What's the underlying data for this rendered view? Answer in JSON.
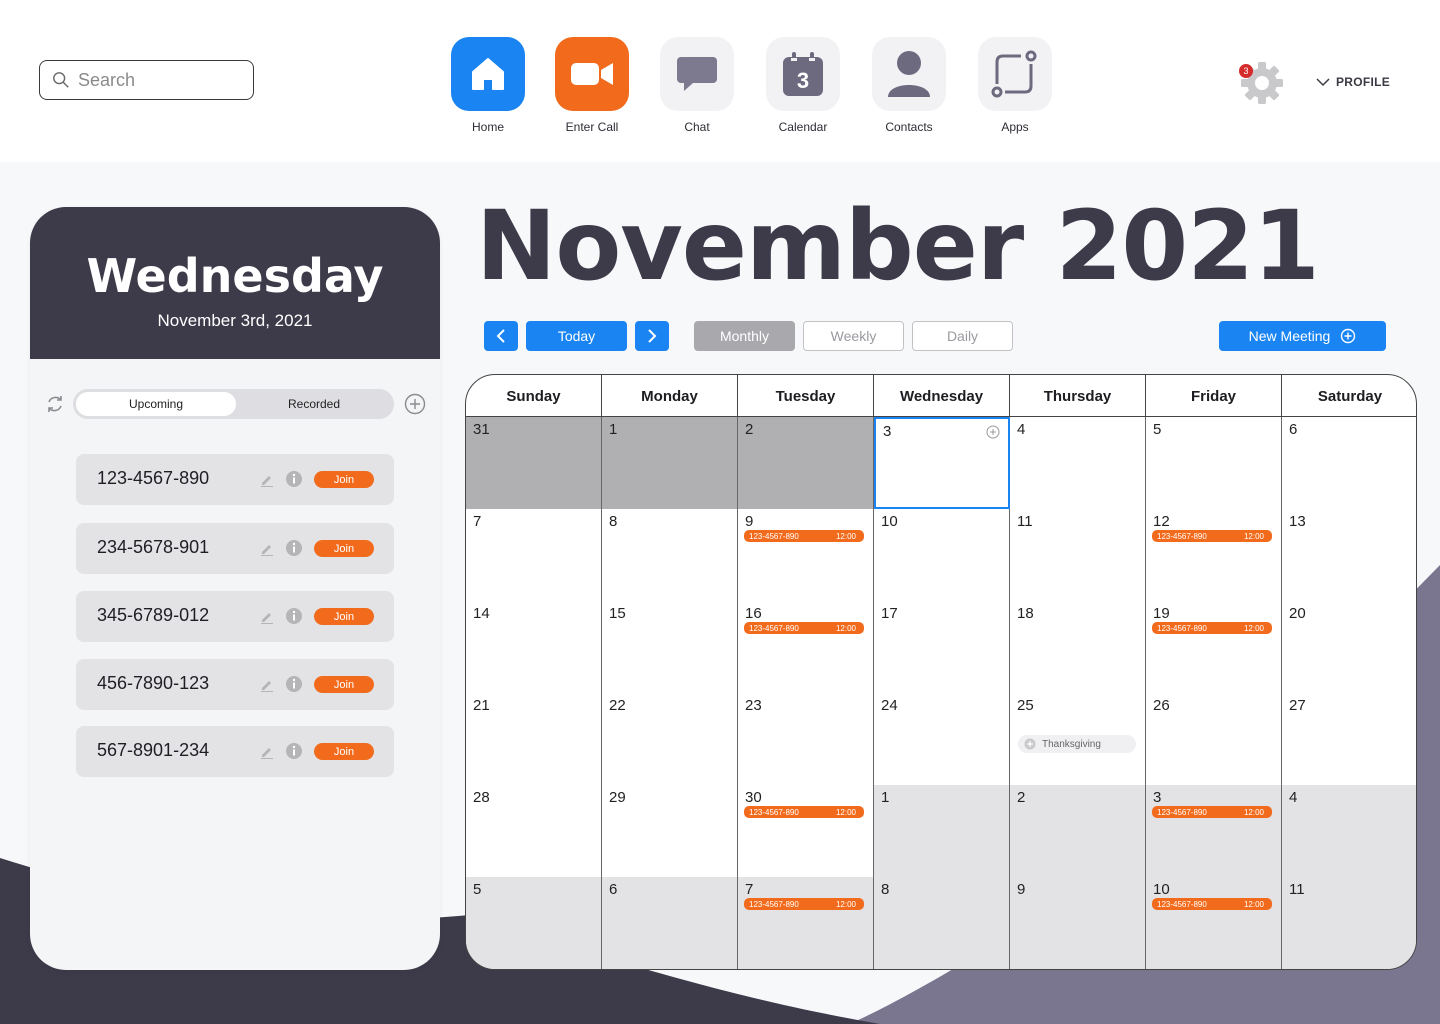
{
  "search": {
    "placeholder": "Search"
  },
  "nav": [
    {
      "label": "Home",
      "icon": "home-icon",
      "color": "#1a85f2"
    },
    {
      "label": "Enter Call",
      "icon": "video-camera-icon",
      "color": "#f26b1d"
    },
    {
      "label": "Chat",
      "icon": "chat-bubble-icon",
      "color": "#f2f2f4"
    },
    {
      "label": "Calendar",
      "icon": "calendar-icon",
      "color": "#f2f2f4",
      "icon_text": "3"
    },
    {
      "label": "Contacts",
      "icon": "person-icon",
      "color": "#f2f2f4"
    },
    {
      "label": "Apps",
      "icon": "apps-icon",
      "color": "#f2f2f4"
    }
  ],
  "settings": {
    "badge": "3"
  },
  "profile": {
    "label": "PROFILE"
  },
  "left_panel": {
    "day": "Wednesday",
    "date": "November 3rd, 2021",
    "tabs": {
      "active": "Upcoming",
      "other": "Recorded"
    },
    "join_label": "Join",
    "meetings": [
      "123-4567-890",
      "234-5678-901",
      "345-6789-012",
      "456-7890-123",
      "567-8901-234"
    ]
  },
  "calendar": {
    "title": "November 2021",
    "today_label": "Today",
    "views": {
      "monthly": "Monthly",
      "weekly": "Weekly",
      "daily": "Daily",
      "active": "Monthly"
    },
    "new_meeting_label": "New Meeting",
    "weekdays": [
      "Sunday",
      "Monday",
      "Tuesday",
      "Wednesday",
      "Thursday",
      "Friday",
      "Saturday"
    ],
    "weeks": [
      [
        {
          "d": "31",
          "t": "prev"
        },
        {
          "d": "1",
          "t": "prev"
        },
        {
          "d": "2",
          "t": "prev"
        },
        {
          "d": "3",
          "t": "today"
        },
        {
          "d": "4"
        },
        {
          "d": "5"
        },
        {
          "d": "6"
        }
      ],
      [
        {
          "d": "7"
        },
        {
          "d": "8"
        },
        {
          "d": "9",
          "ev": true
        },
        {
          "d": "10"
        },
        {
          "d": "11"
        },
        {
          "d": "12",
          "ev": true
        },
        {
          "d": "13"
        }
      ],
      [
        {
          "d": "14"
        },
        {
          "d": "15"
        },
        {
          "d": "16",
          "ev": true
        },
        {
          "d": "17"
        },
        {
          "d": "18"
        },
        {
          "d": "19",
          "ev": true
        },
        {
          "d": "20"
        }
      ],
      [
        {
          "d": "21"
        },
        {
          "d": "22"
        },
        {
          "d": "23"
        },
        {
          "d": "24"
        },
        {
          "d": "25",
          "holiday": true
        },
        {
          "d": "26"
        },
        {
          "d": "27"
        }
      ],
      [
        {
          "d": "28"
        },
        {
          "d": "29"
        },
        {
          "d": "30",
          "ev": true
        },
        {
          "d": "1",
          "t": "next"
        },
        {
          "d": "2",
          "t": "next"
        },
        {
          "d": "3",
          "t": "next",
          "ev": true
        },
        {
          "d": "4",
          "t": "next"
        }
      ],
      [
        {
          "d": "5",
          "t": "next"
        },
        {
          "d": "6",
          "t": "next"
        },
        {
          "d": "7",
          "t": "next",
          "ev": true
        },
        {
          "d": "8",
          "t": "next"
        },
        {
          "d": "9",
          "t": "next"
        },
        {
          "d": "10",
          "t": "next",
          "ev": true
        },
        {
          "d": "11",
          "t": "next"
        }
      ]
    ],
    "event": {
      "number": "123-4567-890",
      "time": "12:00"
    },
    "holiday_label": "Thanksgiving"
  }
}
